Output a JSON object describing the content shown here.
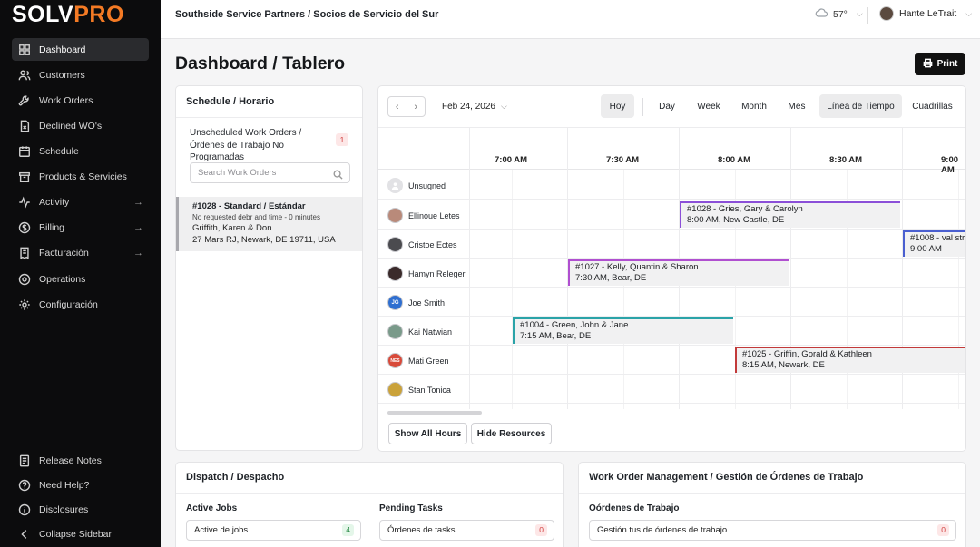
{
  "brand": {
    "prefix": "SOLV",
    "suffix": "PRO",
    "accent": "#f47a24"
  },
  "sidebar": {
    "items": [
      {
        "label": "Dashboard",
        "icon": "dashboard-icon"
      },
      {
        "label": "Customers",
        "icon": "users-icon"
      },
      {
        "label": "Work Orders",
        "icon": "wrench-icon"
      },
      {
        "label": "Declined WO's",
        "icon": "file-x-icon"
      },
      {
        "label": "Schedule",
        "icon": "calendar-icon"
      },
      {
        "label": "Products & Servicies",
        "icon": "box-icon"
      },
      {
        "label": "Activity",
        "icon": "activity-icon"
      },
      {
        "label": "Billing",
        "icon": "dollar-icon"
      },
      {
        "label": "Facturación",
        "icon": "receipt-icon"
      },
      {
        "label": "Operations",
        "icon": "gauge-icon"
      },
      {
        "label": "Configuración",
        "icon": "gear-icon"
      }
    ],
    "footer": [
      {
        "label": "Release Notes",
        "icon": "notes-icon"
      },
      {
        "label": "Need Help?",
        "icon": "help-icon"
      },
      {
        "label": "Disclosures",
        "icon": "info-icon"
      },
      {
        "label": "Collapse Sidebar",
        "icon": "chevron-left-icon"
      }
    ]
  },
  "topbar": {
    "org_title": "Southside Service Partners / Socios de Servicio del Sur",
    "temperature": "57°",
    "user_name": "Hante LeTrait"
  },
  "page": {
    "title": "Dashboard / Tablero",
    "print_label": "Print"
  },
  "schedule": {
    "title": "Schedule / Horario",
    "unscheduled_label": "Unscheduled Work Orders / Órdenes de Trabajo No Programadas",
    "unscheduled_count": "1",
    "search_placeholder": "Search Work Orders",
    "item": {
      "title": "#1028 - Standard / Estándar",
      "subtitle": "No requested debr and time - 0 minutes",
      "customer": "Griffith, Karen & Don",
      "address": "27 Mars RJ, Newark, DE 19711, USA"
    }
  },
  "timeline": {
    "date": "Feb 24, 2026",
    "views": [
      "Hoy",
      "Day",
      "Week",
      "Month",
      "Mes",
      "Línea de Tiempo",
      "Cuadrillas"
    ],
    "times": [
      "7:00 AM",
      "7:30 AM",
      "8:00 AM",
      "8:30 AM",
      "9:00 AM"
    ],
    "resources": [
      {
        "name": "Unsugned",
        "initials": "",
        "color": "#d8d8dc"
      },
      {
        "name": "Ellinoue Letes",
        "initials": "",
        "color": "#b98a7a"
      },
      {
        "name": "Cristoe Ectes",
        "initials": "",
        "color": "#4b4b4f"
      },
      {
        "name": "Hamyn Releger",
        "initials": "",
        "color": "#3a2a2a"
      },
      {
        "name": "Joe Smith",
        "initials": "JG",
        "color": "#2f6fd0"
      },
      {
        "name": "Kai Natwian",
        "initials": "",
        "color": "#7a9a8a"
      },
      {
        "name": "Mati Green",
        "initials": "NES",
        "color": "#d84a3a"
      },
      {
        "name": "Stan Tonica",
        "initials": "",
        "color": "#caa23a"
      }
    ],
    "events": [
      {
        "title": "#1028 - Gries, Gary & Carolyn",
        "detail": "8:00 AM, New Castle, DE",
        "color": "#8b4fd8"
      },
      {
        "title": "#1008 - val strand",
        "detail": "9:00 AM",
        "color": "#4a5fd0"
      },
      {
        "title": "#1027 - Kelly, Quantin & Sharon",
        "detail": "7:30 AM, Bear, DE",
        "color": "#b04fd0"
      },
      {
        "title": "#1004 - Green, John & Jane",
        "detail": "7:15 AM, Bear, DE",
        "color": "#2aa3a8"
      },
      {
        "title": "#1025 - Griffin, Gorald & Kathleen",
        "detail": "8:15 AM, Newark, DE",
        "color": "#c23a3a"
      }
    ],
    "show_all_hours": "Show All Hours",
    "hide_resources": "Hide Resources"
  },
  "dispatch": {
    "title": "Dispatch / Despacho",
    "active_jobs_label": "Active Jobs",
    "active_jobs_box": "Active de jobs",
    "active_jobs_count": "4",
    "pending_label": "Pending Tasks",
    "pending_box": "Órdenes de tasks",
    "pending_count": "0"
  },
  "wom": {
    "title": "Work Order Management / Gestión de Órdenes de Trabajo",
    "orders_label": "Oórdenes de Trabajo",
    "orders_box": "Gestión tus de órdenes de trabajo",
    "orders_count": "0"
  }
}
